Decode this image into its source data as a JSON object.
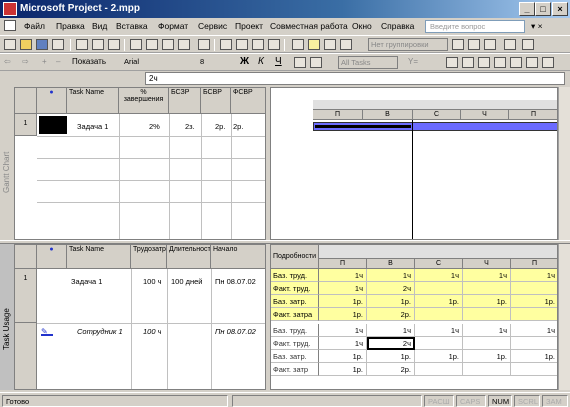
{
  "window": {
    "title": "Microsoft Project - 2.mpp"
  },
  "menu": [
    "Файл",
    "Правка",
    "Вид",
    "Вставка",
    "Формат",
    "Сервис",
    "Проект",
    "Совместная работа",
    "Окно",
    "Справка"
  ],
  "help_placeholder": "Введите вопрос",
  "toolbar": {
    "group_combo": "Нет группировки",
    "show_label": "Показать",
    "font": "Arial",
    "size": "8",
    "bold": "Ж",
    "italic": "К",
    "underline": "Ч",
    "filter_combo": "All Tasks",
    "filter_y": "Y="
  },
  "entry_value": "2ч",
  "gantt": {
    "side_label": "Gantt Chart",
    "columns": [
      "Task Name",
      "% завершения",
      "БСЗР",
      "БСВР",
      "ФСВР"
    ],
    "rows": [
      {
        "id": "1",
        "name": "Задача 1",
        "pct": "2%",
        "bszr": "2з.",
        "bsvr": "2р.",
        "fsvr": "2р."
      }
    ],
    "timescale": [
      "П",
      "В",
      "С",
      "Ч",
      "П"
    ]
  },
  "usage": {
    "side_label": "Task Usage",
    "columns": [
      "Task Name",
      "Трудозатраты",
      "Длительность",
      "Начало"
    ],
    "details_label": "Подробности",
    "timescale": [
      "П",
      "В",
      "С",
      "Ч",
      "П"
    ],
    "rows": [
      {
        "id": "1",
        "name": "Задача 1",
        "work": "100 ч",
        "dur": "100 дней",
        "start": "Пн 08.07.02",
        "details": [
          {
            "label": "Баз. труд.",
            "vals": [
              "1ч",
              "1ч",
              "1ч",
              "1ч",
              "1ч"
            ]
          },
          {
            "label": "Факт. труд.",
            "vals": [
              "1ч",
              "2ч",
              "",
              "",
              ""
            ]
          },
          {
            "label": "Баз. затр.",
            "vals": [
              "1р.",
              "1р.",
              "1р.",
              "1р.",
              "1р."
            ]
          },
          {
            "label": "Факт. затра",
            "vals": [
              "1р.",
              "2р.",
              "",
              "",
              ""
            ]
          }
        ]
      },
      {
        "id": "",
        "name": "Сотрудник 1",
        "work": "100 ч",
        "dur": "",
        "start": "Пн 08.07.02",
        "details": [
          {
            "label": "Баз. труд.",
            "vals": [
              "1ч",
              "1ч",
              "1ч",
              "1ч",
              "1ч"
            ]
          },
          {
            "label": "Факт. труд.",
            "vals": [
              "1ч",
              "2ч",
              "",
              "",
              ""
            ]
          },
          {
            "label": "Баз. затр.",
            "vals": [
              "1р.",
              "1р.",
              "1р.",
              "1р.",
              "1р."
            ]
          },
          {
            "label": "Факт. затр",
            "vals": [
              "1р.",
              "2р.",
              "",
              "",
              ""
            ]
          }
        ]
      }
    ]
  },
  "status": {
    "ready": "Готово",
    "ext": "РАСШ",
    "caps": "CAPS",
    "num": "NUM",
    "scrl": "SCRL",
    "ovr": "ЗАМ"
  }
}
